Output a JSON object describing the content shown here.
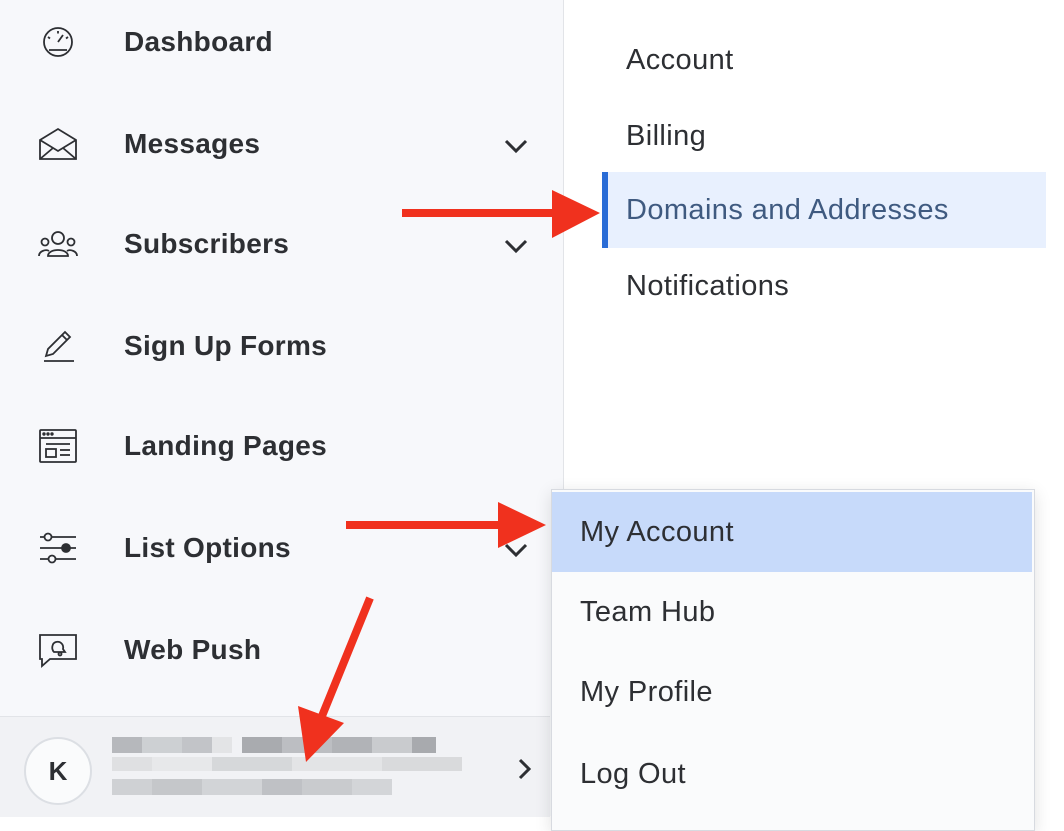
{
  "sidebar": {
    "items": [
      {
        "label": "Dashboard",
        "icon": "dashboard-gauge-icon",
        "has_chevron": false
      },
      {
        "label": "Messages",
        "icon": "envelope-icon",
        "has_chevron": true
      },
      {
        "label": "Subscribers",
        "icon": "users-icon",
        "has_chevron": true
      },
      {
        "label": "Sign Up Forms",
        "icon": "pencil-icon",
        "has_chevron": false
      },
      {
        "label": "Landing Pages",
        "icon": "browser-window-icon",
        "has_chevron": false
      },
      {
        "label": "List Options",
        "icon": "sliders-icon",
        "has_chevron": true
      },
      {
        "label": "Web Push",
        "icon": "chat-bell-icon",
        "has_chevron": false
      }
    ],
    "user": {
      "avatar_initial": "K"
    }
  },
  "settings_nav": {
    "items": [
      "Account",
      "Billing",
      "Domains and Addresses",
      "Notifications"
    ],
    "active": "Domains and Addresses"
  },
  "account_menu": {
    "items": [
      "My Account",
      "Team Hub",
      "My Profile",
      "Log Out"
    ],
    "highlighted": "My Account"
  },
  "colors": {
    "sidebar_bg": "#f7f8fb",
    "active_bg": "#e8f0fe",
    "active_border": "#2a6cd6",
    "menu_highlight": "#c7dafa",
    "arrow": "#f0311e"
  }
}
